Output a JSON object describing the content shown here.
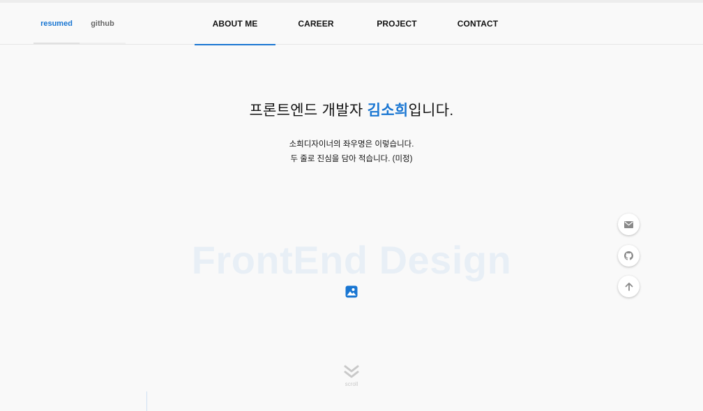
{
  "header": {
    "brand_tabs": [
      {
        "label": "resumed",
        "active": true
      },
      {
        "label": "github",
        "active": false
      }
    ],
    "nav": [
      {
        "label": "ABOUT ME",
        "active": true
      },
      {
        "label": "CAREER",
        "active": false
      },
      {
        "label": "PROJECT",
        "active": false
      },
      {
        "label": "CONTACT",
        "active": false
      }
    ]
  },
  "hero": {
    "headline_prefix": "프론트엔드 개발자 ",
    "headline_name": "김소희",
    "headline_suffix": "입니다.",
    "desc_line1": "소희디자이너의 좌우명은 이렇습니다.",
    "desc_line2": "두 줄로 진심을 담아 적습니다. (미정)",
    "background_word": "FrontEnd Design",
    "image_icon": "image-icon"
  },
  "floating": [
    {
      "icon": "mail-icon"
    },
    {
      "icon": "github-icon"
    },
    {
      "icon": "arrow-up-icon"
    }
  ],
  "scroll": {
    "label": "scroll",
    "icon": "double-chevron-down-icon"
  },
  "colors": {
    "accent": "#1976d2",
    "background": "#f9f9f9"
  }
}
